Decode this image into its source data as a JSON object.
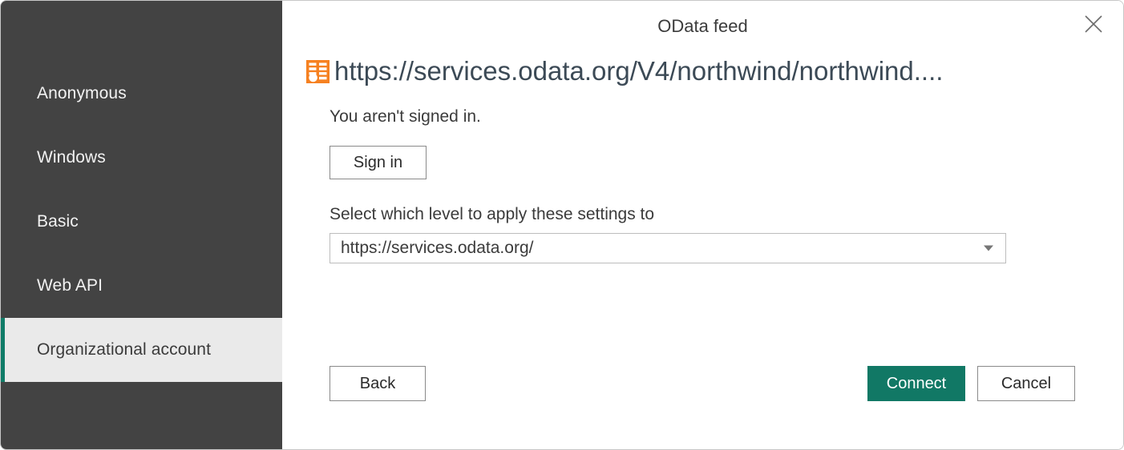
{
  "dialog": {
    "title": "OData feed",
    "close_icon": "close-icon"
  },
  "sidebar": {
    "items": [
      {
        "label": "Anonymous",
        "selected": false
      },
      {
        "label": "Windows",
        "selected": false
      },
      {
        "label": "Basic",
        "selected": false
      },
      {
        "label": "Web API",
        "selected": false
      },
      {
        "label": "Organizational account",
        "selected": true
      }
    ],
    "accent_color": "#107c68",
    "background_color": "#434343",
    "selected_background_color": "#eaeaea"
  },
  "header": {
    "source_icon": "odata-table-icon",
    "source_icon_color": "#f68121",
    "url": "https://services.odata.org/V4/northwind/northwind...."
  },
  "main": {
    "status_message": "You aren't signed in.",
    "sign_in_label": "Sign in",
    "level_label": "Select which level to apply these settings to",
    "level_value": "https://services.odata.org/",
    "level_options": [
      "https://services.odata.org/"
    ],
    "dropdown_icon": "chevron-down-icon"
  },
  "footer": {
    "back_label": "Back",
    "connect_label": "Connect",
    "cancel_label": "Cancel",
    "connect_color": "#117865"
  }
}
